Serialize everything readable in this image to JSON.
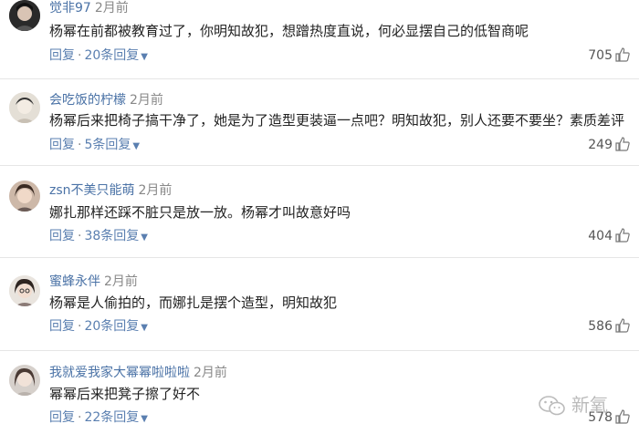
{
  "comments": [
    {
      "username": "觉非97",
      "time": "2月前",
      "text": "杨幂在前都被教育过了，你明知故犯，想蹭热度直说，何必显摆自己的低智商呢",
      "reply": "回复",
      "reply_count": "20条回复",
      "likes": "705",
      "avatar_color": "#3a3a3a"
    },
    {
      "username": "会吃饭的柠檬",
      "time": "2月前",
      "text": "杨幂后来把椅子搞干净了，她是为了造型更装逼一点吧？明知故犯，别人还要不要坐？素质差评",
      "reply": "回复",
      "reply_count": "5条回复",
      "likes": "249",
      "avatar_color": "#d8d2c6"
    },
    {
      "username": "zsn不美只能萌",
      "time": "2月前",
      "text": "娜扎那样还踩不脏只是放一放。杨幂才叫故意好吗",
      "reply": "回复",
      "reply_count": "38条回复",
      "likes": "404",
      "avatar_color": "#b89a86"
    },
    {
      "username": "蜜蜂永伴",
      "time": "2月前",
      "text": "杨幂是人偷拍的，而娜扎是摆个造型，明知故犯",
      "reply": "回复",
      "reply_count": "20条回复",
      "likes": "586",
      "avatar_color": "#c9b0a0"
    },
    {
      "username": "我就爱我家大幂幂啦啦啦",
      "time": "2月前",
      "text": "幂幂后来把凳子擦了好不",
      "reply": "回复",
      "reply_count": "22条回复",
      "likes": "578",
      "avatar_color": "#9a8f88"
    }
  ],
  "watermark": "新氧",
  "colors": {
    "username": "#4a72a6",
    "action": "#5a7fb0",
    "divider": "#e6e6e6"
  }
}
